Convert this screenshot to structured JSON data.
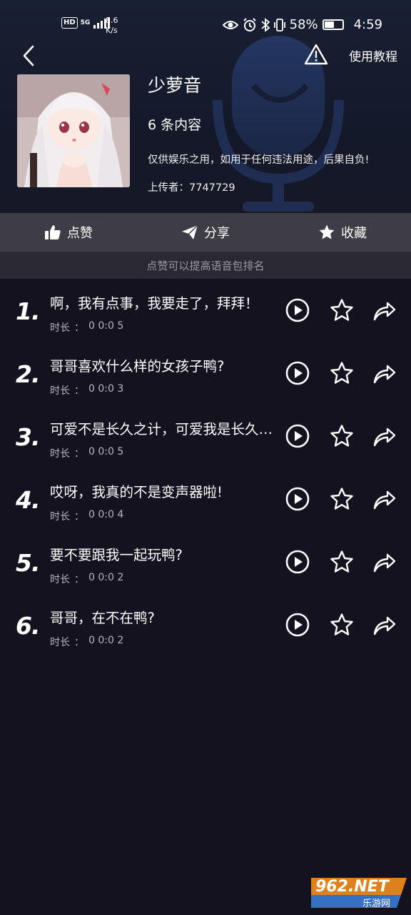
{
  "status_bar": {
    "hd": "HD",
    "network": "5G",
    "speed_value": "8.6",
    "speed_unit": "K/s",
    "battery_percent": "58%",
    "battery_level": 0.58,
    "time": "4:59"
  },
  "header": {
    "tutorial_label": "使用教程",
    "title": "少萝音",
    "count_text": "6 条内容",
    "disclaimer": "仅供娱乐之用，如用于任何违法用途，后果自负!",
    "uploader_label": "上传者：",
    "uploader_id": "7747729"
  },
  "actions": {
    "like_label": "点赞",
    "share_label": "分享",
    "collect_label": "收藏"
  },
  "tip_text": "点赞可以提高语音包排名",
  "duration_label": "时长",
  "duration_sep": "：",
  "items": [
    {
      "num": "1.",
      "title": "啊，我有点事，我要走了，拜拜！",
      "duration": "0 0:0 5"
    },
    {
      "num": "2.",
      "title": "哥哥喜欢什么样的女孩子鸭?",
      "duration": "0 0:0 3"
    },
    {
      "num": "3.",
      "title": "可爱不是长久之计，可爱我是长久之计",
      "duration": "0 0:0 5"
    },
    {
      "num": "4.",
      "title": "哎呀，我真的不是变声器啦!",
      "duration": "0 0:0 4"
    },
    {
      "num": "5.",
      "title": "要不要跟我一起玩鸭?",
      "duration": "0 0:0 2"
    },
    {
      "num": "6.",
      "title": "哥哥，在不在鸭?",
      "duration": "0 0:0 2"
    }
  ],
  "watermark_text": "962.NET",
  "watermark_sub": "乐游网"
}
